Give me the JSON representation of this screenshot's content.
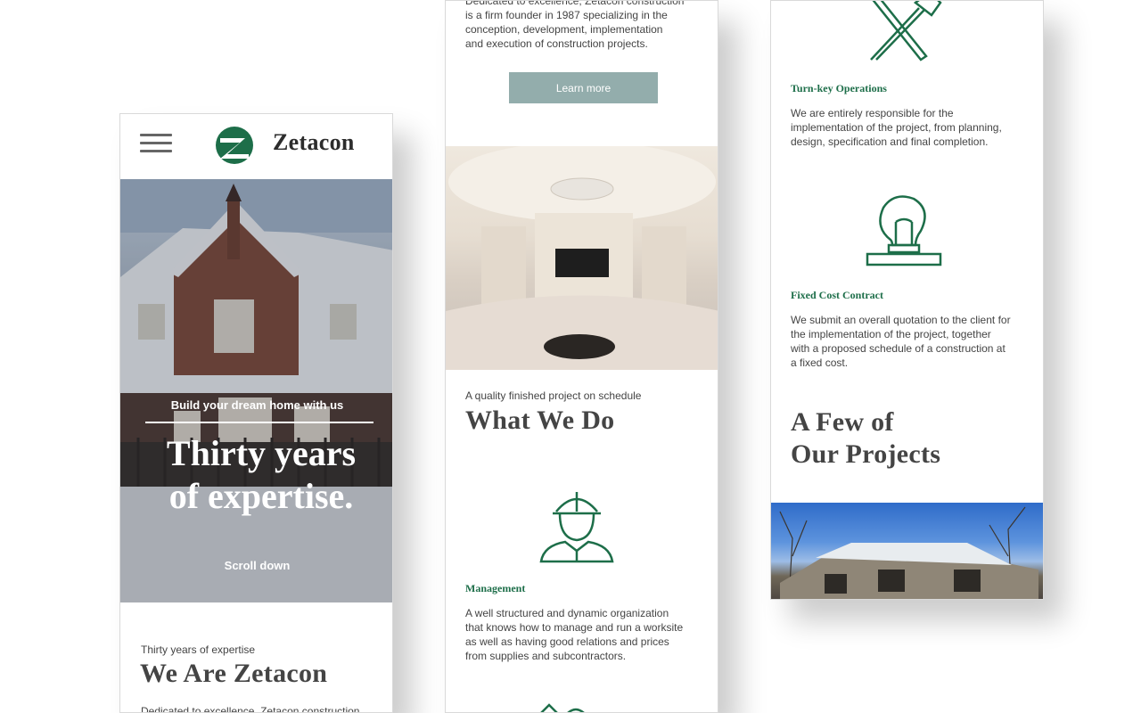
{
  "colors": {
    "accent": "#1d6e49",
    "button": "#93adac"
  },
  "brand": {
    "name": "Zetacon",
    "logo_icon": "z-logo-icon"
  },
  "hero": {
    "subtitle": "Build your dream home with us",
    "title_line1": "Thirty years",
    "title_line2": "of expertise.",
    "scroll": "Scroll down"
  },
  "about": {
    "eyebrow": "Thirty years of expertise",
    "title": "We Are Zetacon",
    "text_cut": "Dedicated to excellence, Zetacon construction",
    "text_top": "Dedicated to excellence, Zetacon construction",
    "text": [
      "is a firm founder in 1987 specializing in the",
      "conception, development, implementation",
      "and execution of construction projects."
    ],
    "button": "Learn more"
  },
  "services": {
    "eyebrow": "A quality finished project on schedule",
    "title": "What We Do",
    "items": [
      {
        "icon": "worker-helmet-icon",
        "title": "Management",
        "lines": [
          "A well structured and dynamic organization",
          "that knows how to manage and run a worksite",
          "as well as having good relations and prices",
          "from supplies and subcontractors."
        ]
      },
      {
        "icon": "tools-icon",
        "title": "Turn-key Operations",
        "lines": [
          "We are entirely responsible for the",
          "implementation of the project, from planning,",
          "design, specification and final completion."
        ]
      },
      {
        "icon": "lightbulb-icon",
        "title": "Fixed Cost Contract",
        "lines": [
          "We submit an overall quotation to the client for",
          "the implementation of the project, together",
          "with a proposed schedule of a construction at",
          "a fixed cost."
        ]
      }
    ]
  },
  "projects": {
    "title_line1": "A Few of",
    "title_line2": "Our Projects"
  }
}
